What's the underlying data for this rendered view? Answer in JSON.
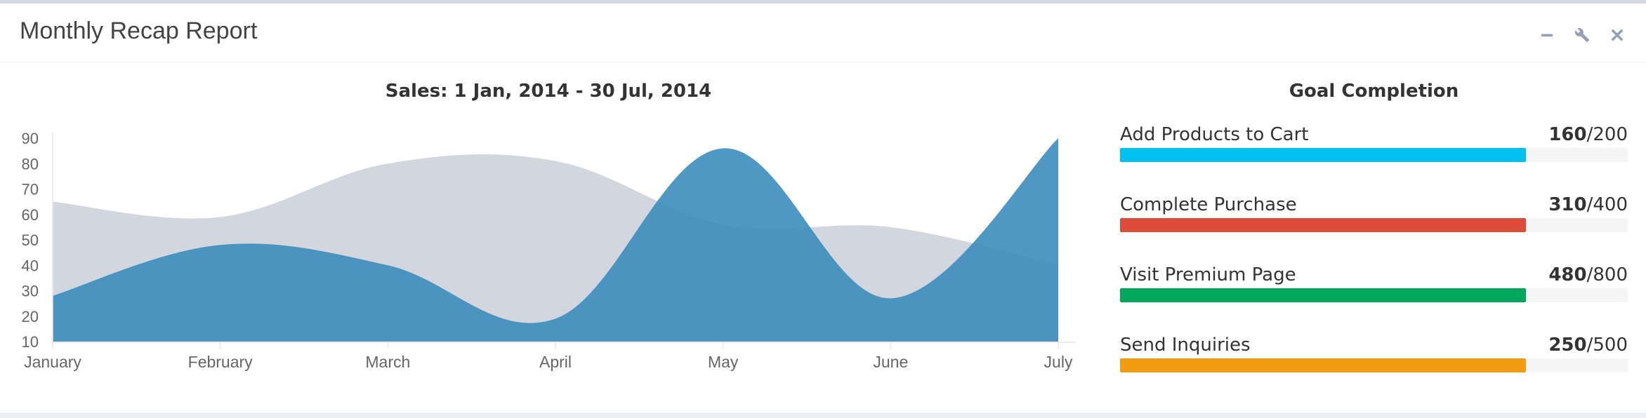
{
  "box": {
    "title": "Monthly Recap Report",
    "tools": {
      "collapse_icon": "minus-icon",
      "settings_icon": "wrench-icon",
      "remove_icon": "close-icon"
    }
  },
  "chart_data": {
    "type": "area",
    "title": "Sales: 1 Jan, 2014 - 30 Jul, 2014",
    "categories": [
      "January",
      "February",
      "March",
      "April",
      "May",
      "June",
      "July"
    ],
    "yticks": [
      10,
      20,
      30,
      40,
      50,
      60,
      70,
      80,
      90
    ],
    "ylim": [
      10,
      90
    ],
    "grid": false,
    "series": [
      {
        "color": "#d2d6de",
        "values": [
          65,
          59,
          80,
          81,
          56,
          55,
          40
        ]
      },
      {
        "color": "#3c8dbc",
        "values": [
          28,
          48,
          40,
          19,
          86,
          27,
          90
        ]
      }
    ]
  },
  "goals": {
    "title": "Goal Completion",
    "items": [
      {
        "label": "Add Products to Cart",
        "value": "160",
        "total": "/200",
        "fraction": 0.8,
        "color": "#00c0ef"
      },
      {
        "label": "Complete Purchase",
        "value": "310",
        "total": "/400",
        "fraction": 0.8,
        "color": "#dd4b39"
      },
      {
        "label": "Visit Premium Page",
        "value": "480",
        "total": "/800",
        "fraction": 0.8,
        "color": "#00a65a"
      },
      {
        "label": "Send Inquiries",
        "value": "250",
        "total": "/500",
        "fraction": 0.8,
        "color": "#f39c12"
      }
    ]
  }
}
